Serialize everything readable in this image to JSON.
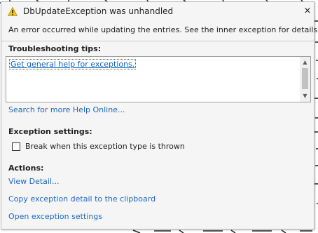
{
  "dialog": {
    "title": "DbUpdateException was unhandled",
    "close_glyph": "×",
    "message": "An error occurred while updating the entries. See the inner exception for details.",
    "troubleshooting": {
      "heading": "Troubleshooting tips:",
      "tips": [
        "Get general help for exceptions."
      ],
      "search_link": "Search for more Help Online..."
    },
    "exception_settings": {
      "heading": "Exception settings:",
      "break_checkbox": {
        "label": "Break when this exception type is thrown",
        "checked": false
      }
    },
    "actions": {
      "heading": "Actions:",
      "links": [
        "View Detail...",
        "Copy exception detail to the clipboard",
        "Open exception settings"
      ]
    },
    "icons": {
      "title_icon": "warning-icon",
      "close_icon": "close-icon",
      "scroll_up": "chevron-up-icon",
      "scroll_down": "chevron-down-icon"
    },
    "colors": {
      "link": "#1d68c4",
      "warning": "#f2c81a",
      "panel": "#f5f5f5"
    }
  }
}
